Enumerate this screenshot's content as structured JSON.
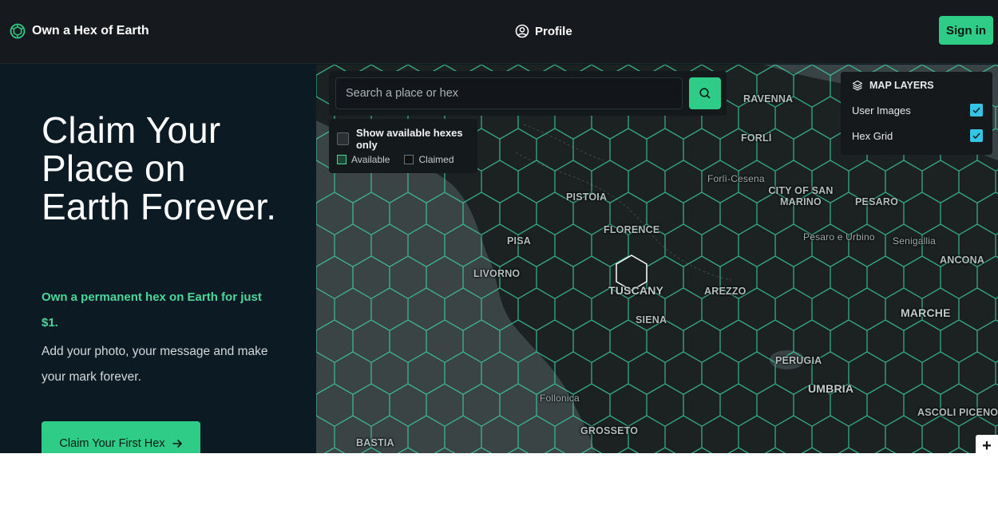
{
  "header": {
    "brand_name": "Own a Hex of Earth",
    "brand_icon": "globe-hex-icon",
    "profile_label": "Profile",
    "profile_icon": "user-circle-icon",
    "signin_label": "Sign in"
  },
  "hero": {
    "title": "Claim Your Place on Earth Forever.",
    "lead": "Own a permanent hex on Earth for just $1.",
    "subtitle": "Add your photo, your message and make your mark forever.",
    "cta_label": "Claim Your First Hex",
    "cta_icon": "arrow-right-icon"
  },
  "map": {
    "search": {
      "placeholder": "Search a place or hex",
      "value": "",
      "button_icon": "search-icon"
    },
    "filter": {
      "show_available_label": "Show available hexes only",
      "show_available_checked": false,
      "legend_available": "Available",
      "legend_claimed": "Claimed"
    },
    "layers": {
      "title": "MAP LAYERS",
      "icon": "layers-icon",
      "items": [
        {
          "label": "User Images",
          "checked": true
        },
        {
          "label": "Hex Grid",
          "checked": true
        }
      ]
    },
    "zoom_in_label": "+",
    "places": {
      "ravenna": "RAVENNA",
      "forli": "FORLÌ",
      "forli_cesena": "Forlì-Cesena",
      "san_marino": "CITY OF SAN MARINO",
      "pesaro": "PESARO",
      "pistoia": "PISTOIA",
      "florence": "FLORENCE",
      "pisa": "PISA",
      "pesaro_urbino": "Pesaro e Urbino",
      "senigallia": "Senigallia",
      "ancona": "ANCONA",
      "livorno": "LIVORNO",
      "tuscany": "TUSCANY",
      "arezzo": "AREZZO",
      "marche": "MARCHE",
      "siena": "SIENA",
      "perugia": "PERUGIA",
      "umbria": "UMBRIA",
      "follonica": "Follonica",
      "ascoli_piceno": "ASCOLI PICENO",
      "grosseto": "GROSSETO",
      "bastia": "BASTIA"
    },
    "colors": {
      "hex_stroke": "#3fd6a6",
      "land": "#1c2222",
      "sea": "#3a4445",
      "accent": "#2ecc86"
    }
  }
}
